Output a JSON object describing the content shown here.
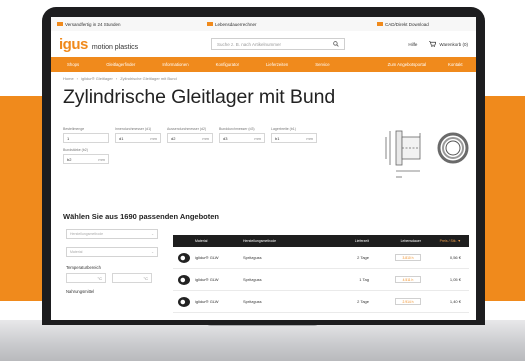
{
  "topbar": {
    "shipping": "Versandfertig in 24 Stunden",
    "live_calc": "Lebensdauerrechner",
    "cad": "CAD/Direkt Download"
  },
  "header": {
    "logo_mark": "igus",
    "logo_text": "motion plastics",
    "search_placeholder": "Suche z. B. nach Artikelnummer",
    "help": "Hilfe",
    "cart": "Warenkorb (0)"
  },
  "nav": {
    "items": [
      "Shops",
      "Gleitlagerfinder",
      "Informationen",
      "Konfigurator",
      "Lieferzeiten",
      "Service",
      "Zum Angebotsportal",
      "Kontakt"
    ]
  },
  "breadcrumb": [
    "Home",
    "iglidur® Gleitlager",
    "Zylindrische Gleitlager mit Bund"
  ],
  "page": {
    "title": "Zylindrische Gleitlager mit Bund",
    "result_count": "Wählen Sie aus 1690 passenden Angeboten"
  },
  "params": {
    "row1": [
      {
        "label": "Bestellmenge",
        "value": "1",
        "unit": ""
      },
      {
        "label": "Innendurchmesser (d1)",
        "value": "d1",
        "unit": "mm"
      },
      {
        "label": "Aussendurchmesser (d2)",
        "value": "d2",
        "unit": "mm"
      },
      {
        "label": "Bunddurchmesser (d3)",
        "value": "d3",
        "unit": "mm"
      },
      {
        "label": "Lagerbreite (b1)",
        "value": "b1",
        "unit": "mm"
      }
    ],
    "row2": [
      {
        "label": "Bundstärke (b2)",
        "value": "b2",
        "unit": "mm"
      }
    ]
  },
  "filters": {
    "select1": "Herstellungsmethode",
    "select2": "Material",
    "temp_label": "Temperaturbereich",
    "temp_unit": "°C",
    "food_label": "Nahrungsmittel"
  },
  "table": {
    "headers": [
      "Material",
      "Herstellungsmethode",
      "Lieferzeit",
      "Lebensdauer",
      "Preis / Stk."
    ],
    "rows": [
      {
        "material": "iglidur® GLW",
        "process": "Spritzguss",
        "delivery": "2 Tage",
        "life": "3.810 h",
        "price": "0,56 €"
      },
      {
        "material": "iglidur® GLW",
        "process": "Spritzguss",
        "delivery": "1 Tag",
        "life": "4.511 h",
        "price": "1,05 €"
      },
      {
        "material": "iglidur® GLW",
        "process": "Spritzguss",
        "delivery": "2 Tage",
        "life": "2.914 h",
        "price": "1,40 €"
      }
    ]
  },
  "colors": {
    "brand_orange": "#f08a1c",
    "header_dark": "#1e1e1e"
  }
}
